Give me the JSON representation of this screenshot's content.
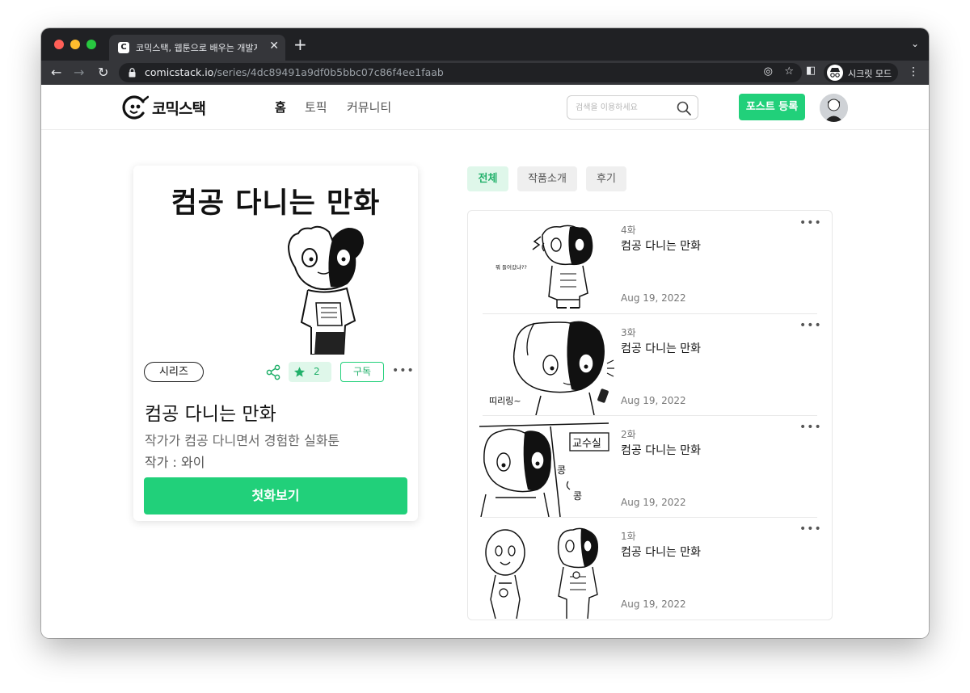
{
  "browser": {
    "tab_title": "코믹스택, 웹툰으로 배우는 개발지식",
    "tab_favicon": "C",
    "url_host": "comicstack.io",
    "url_path": "/series/4dc89491a9df0b5bbc07c86f4ee1faab",
    "profile_label": "시크릿 모드"
  },
  "site": {
    "logo_text": "코믹스택",
    "nav": [
      {
        "label": "홈",
        "active": true
      },
      {
        "label": "토픽"
      },
      {
        "label": "커뮤니티"
      }
    ],
    "search_placeholder": "검색을 이용하세요",
    "post_button": "포스트 등록"
  },
  "series": {
    "cover_title": "컴공 다니는 만화",
    "tag": "시리즈",
    "star_count": "2",
    "subscribe_label": "구독",
    "name": "컴공 다니는 만화",
    "description": "작가가 컴공 다니면서 경험한 실화툰",
    "author": "작가 : 와이",
    "first_episode_button": "첫화보기"
  },
  "filters": [
    {
      "label": "전체",
      "active": true
    },
    {
      "label": "작품소개"
    },
    {
      "label": "후기"
    }
  ],
  "episodes": [
    {
      "number": "4화",
      "title": "컴공 다니는 만화",
      "date": "Aug 19, 2022",
      "thumb_text": "뭐 들어갔냐??"
    },
    {
      "number": "3화",
      "title": "컴공 다니는 만화",
      "date": "Aug 19, 2022",
      "thumb_text": "띠리링~"
    },
    {
      "number": "2화",
      "title": "컴공 다니는 만화",
      "date": "Aug 19, 2022",
      "thumb_text": "교수실",
      "thumb_text2": "콩",
      "thumb_text3": "콩"
    },
    {
      "number": "1화",
      "title": "컴공 다니는 만화",
      "date": "Aug 19, 2022"
    }
  ],
  "colors": {
    "brand_green": "#21d07a",
    "light_green": "#dff7ea",
    "chrome_dark": "#202124",
    "chrome_toolbar": "#35363a"
  }
}
